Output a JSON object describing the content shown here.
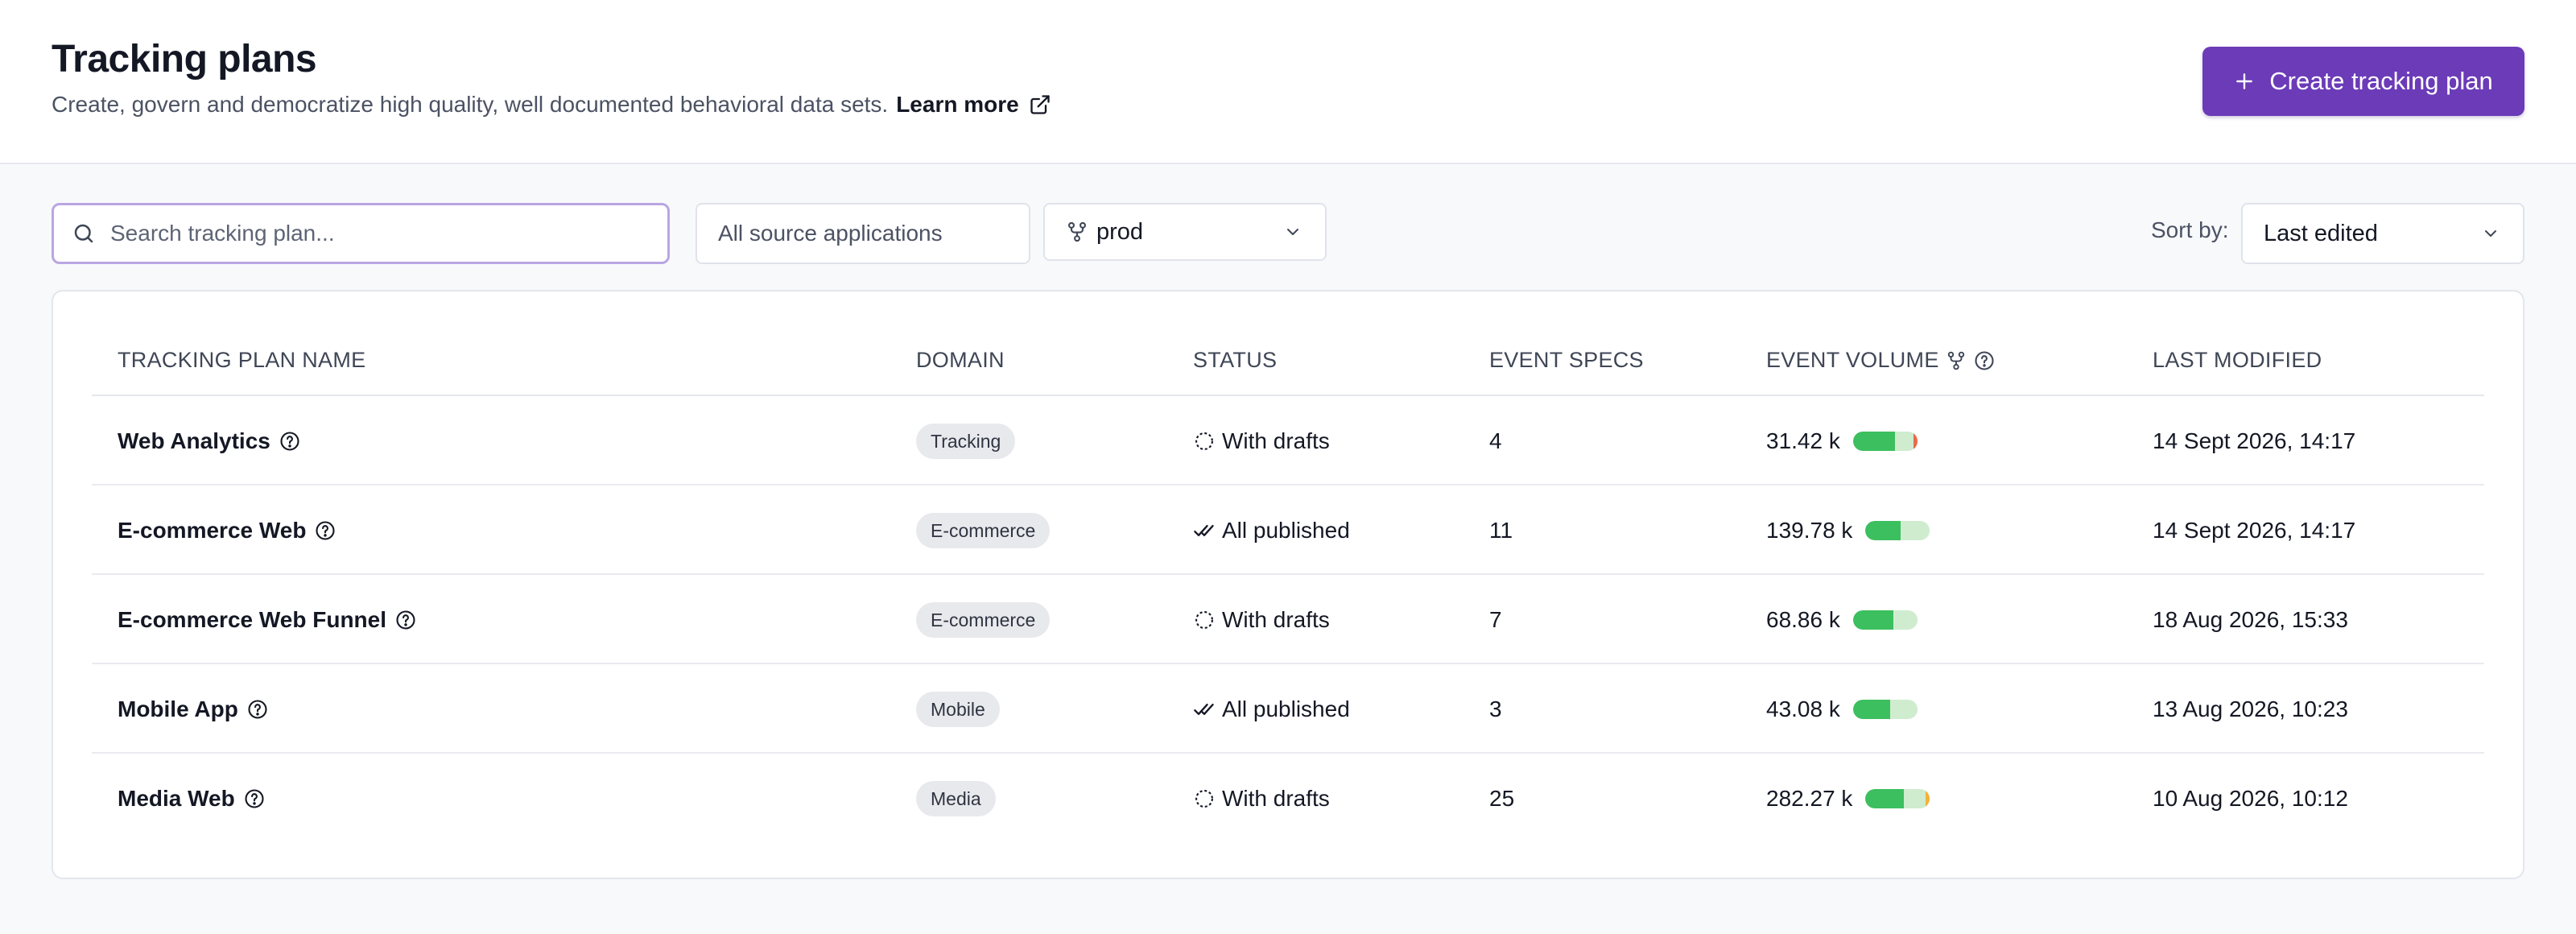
{
  "header": {
    "title": "Tracking plans",
    "subtitle": "Create, govern and democratize high quality, well documented behavioral data sets.",
    "learn_more": "Learn more",
    "create_button": "Create tracking plan"
  },
  "filters": {
    "search_placeholder": "Search tracking plan...",
    "source_select": "All source applications",
    "branch_select": "prod",
    "sort_label": "Sort by:",
    "sort_value": "Last edited"
  },
  "table": {
    "columns": {
      "name": "TRACKING PLAN NAME",
      "domain": "DOMAIN",
      "status": "STATUS",
      "specs": "EVENT SPECS",
      "volume": "EVENT VOLUME",
      "modified": "LAST MODIFIED"
    },
    "rows": [
      {
        "name": "Web Analytics",
        "domain": "Tracking",
        "status": "With drafts",
        "status_type": "drafts",
        "specs": "4",
        "volume": "31.42 k",
        "volume_fill": 0.65,
        "volume_tip": "#e86a4a",
        "modified": "14 Sept 2026, 14:17"
      },
      {
        "name": "E-commerce Web",
        "domain": "E-commerce",
        "status": "All published",
        "status_type": "published",
        "specs": "11",
        "volume": "139.78 k",
        "volume_fill": 0.55,
        "volume_tip": "#cfeccf",
        "modified": "14 Sept 2026, 14:17"
      },
      {
        "name": "E-commerce Web Funnel",
        "domain": "E-commerce",
        "status": "With drafts",
        "status_type": "drafts",
        "specs": "7",
        "volume": "68.86 k",
        "volume_fill": 0.62,
        "volume_tip": "#cfeccf",
        "modified": "18 Aug 2026, 15:33"
      },
      {
        "name": "Mobile App",
        "domain": "Mobile",
        "status": "All published",
        "status_type": "published",
        "specs": "3",
        "volume": "43.08 k",
        "volume_fill": 0.58,
        "volume_tip": "#cfeccf",
        "modified": "13 Aug 2026, 10:23"
      },
      {
        "name": "Media Web",
        "domain": "Media",
        "status": "With drafts",
        "status_type": "drafts",
        "specs": "25",
        "volume": "282.27 k",
        "volume_fill": 0.6,
        "volume_tip": "#f2b23a",
        "modified": "10 Aug 2026, 10:12"
      }
    ]
  },
  "colors": {
    "accent": "#6b3bb8",
    "bar_fill": "#3cbf5e",
    "bar_track": "#cfeccf"
  }
}
